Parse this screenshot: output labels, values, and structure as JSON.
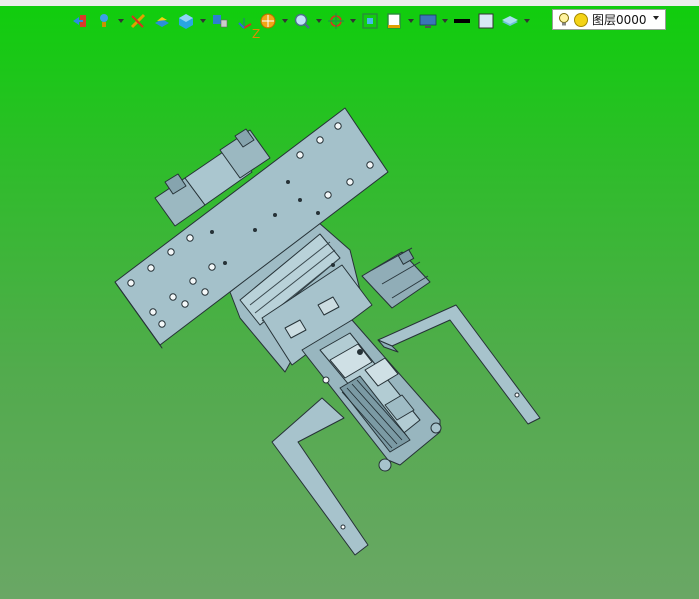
{
  "toolbar": {
    "items": [
      {
        "icon": "exit-arrow-icon"
      },
      {
        "icon": "light-icon",
        "has_dropdown": true
      },
      {
        "icon": "pencil-cut-icon"
      },
      {
        "icon": "paint-block-icon"
      },
      {
        "icon": "cube-view-icon",
        "has_dropdown": true
      },
      {
        "icon": "render-icon"
      },
      {
        "icon": "section-icon",
        "has_dropdown": true
      },
      {
        "icon": "zoom-icon",
        "has_dropdown": true
      },
      {
        "icon": "pan-rotate-icon",
        "has_dropdown": true
      },
      {
        "icon": "fit-view-icon"
      },
      {
        "icon": "frame-icon",
        "has_dropdown": true
      },
      {
        "icon": "display-icon",
        "has_dropdown": true
      },
      {
        "icon": "line-color-icon"
      },
      {
        "icon": "fill-color-icon"
      },
      {
        "icon": "layer-stack-icon",
        "has_dropdown": true
      }
    ],
    "axis_label": "Z"
  },
  "layer_selector": {
    "value": "图层0000"
  },
  "colors": {
    "background_top": "#0fce0c",
    "background_bottom": "#6aa765",
    "model_fill": "#a7c3cc",
    "model_stroke": "#263237",
    "accent_orange": "#e08a00"
  }
}
